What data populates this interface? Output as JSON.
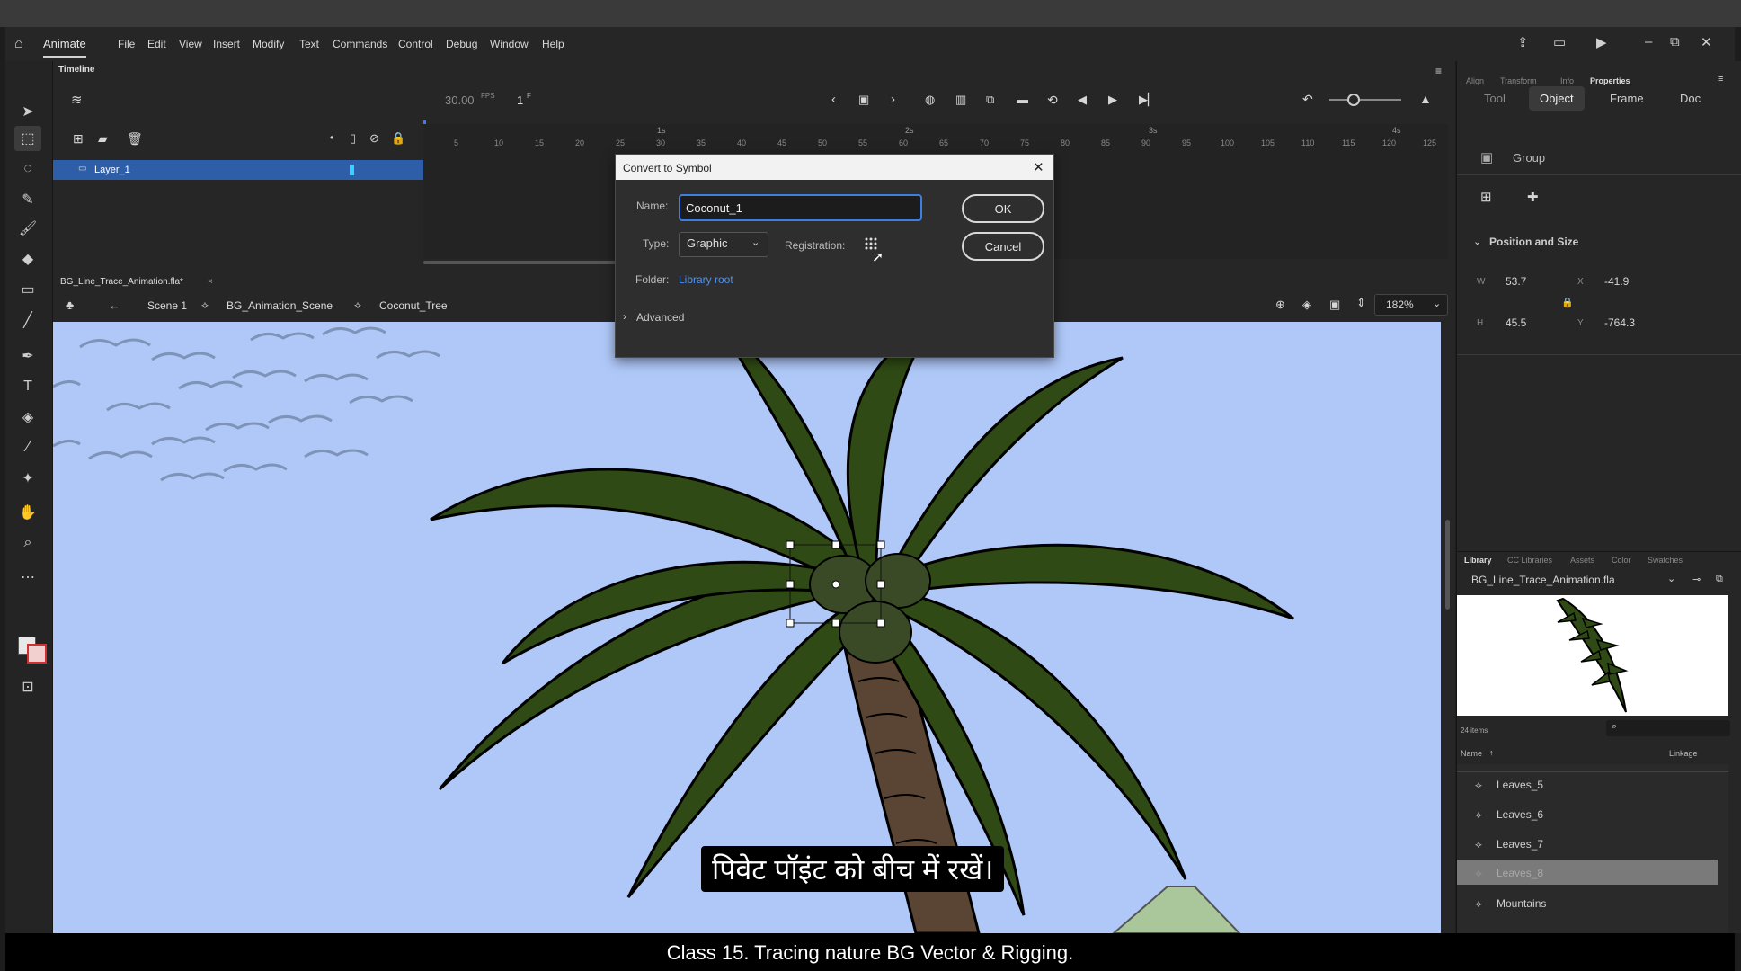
{
  "app": {
    "name": "Animate"
  },
  "menu": [
    "File",
    "Edit",
    "View",
    "Insert",
    "Modify",
    "Text",
    "Commands",
    "Control",
    "Debug",
    "Window",
    "Help"
  ],
  "timeline": {
    "panel_title": "Timeline",
    "fps": "30.00",
    "fps_unit": "FPS",
    "frame": "1",
    "frame_unit": "F",
    "layer_name": "Layer_1",
    "ruler_top": [
      "1s",
      "2s",
      "3s",
      "4s"
    ],
    "ruler": [
      "5",
      "10",
      "15",
      "20",
      "25",
      "30",
      "35",
      "40",
      "45",
      "50",
      "55",
      "60",
      "65",
      "70",
      "75",
      "80",
      "85",
      "90",
      "95",
      "100",
      "105",
      "110",
      "115",
      "120",
      "125"
    ]
  },
  "document": {
    "tab": "BG_Line_Trace_Animation.fla*",
    "breadcrumb": [
      "Scene 1",
      "BG_Animation_Scene",
      "Coconut_Tree"
    ],
    "zoom": "182%"
  },
  "dialog": {
    "title": "Convert to Symbol",
    "name_label": "Name:",
    "name_value": "Coconut_1",
    "type_label": "Type:",
    "type_value": "Graphic",
    "registration_label": "Registration:",
    "folder_label": "Folder:",
    "folder_value": "Library root",
    "advanced_label": "Advanced",
    "ok": "OK",
    "cancel": "Cancel"
  },
  "properties": {
    "top_tabs": [
      "Align",
      "Transform",
      "Info",
      "Properties"
    ],
    "tabs": [
      "Tool",
      "Object",
      "Frame",
      "Doc"
    ],
    "active_tab": "Object",
    "group_label": "Group",
    "section": "Position and Size",
    "w_label": "W",
    "w": "53.7",
    "h_label": "H",
    "h": "45.5",
    "x_label": "X",
    "x": "-41.9",
    "y_label": "Y",
    "y": "-764.3"
  },
  "library": {
    "tabs": [
      "Library",
      "CC Libraries",
      "Assets",
      "Color",
      "Swatches"
    ],
    "file": "BG_Line_Trace_Animation.fla",
    "count": "24 items",
    "col_name": "Name",
    "col_linkage": "Linkage",
    "items": [
      "Leaves_5",
      "Leaves_6",
      "Leaves_7",
      "Leaves_8",
      "Mountains"
    ],
    "selected": "Leaves_8"
  },
  "subtitle": "पिवेट पॉइंट को बीच में रखें।",
  "caption": "Class 15. Tracing nature BG Vector & Rigging.",
  "colors": {
    "stage_bg": "#afc8f8",
    "leaf": "#2f4a14",
    "trunk": "#5a4434",
    "accent": "#3d7fe0"
  }
}
